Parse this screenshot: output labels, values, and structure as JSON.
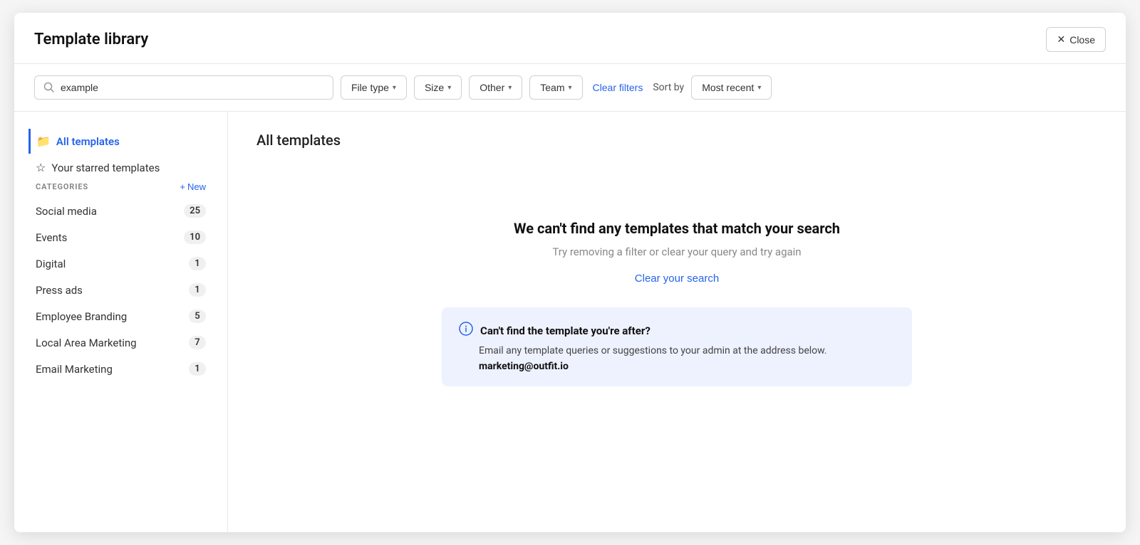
{
  "modal": {
    "title": "Template library"
  },
  "header": {
    "close_label": "Close",
    "close_icon": "×"
  },
  "toolbar": {
    "search_value": "example",
    "search_placeholder": "Search",
    "file_type_label": "File type",
    "size_label": "Size",
    "other_label": "Other",
    "team_label": "Team",
    "clear_filters_label": "Clear filters",
    "sort_by_label": "Sort by",
    "sort_value": "Most recent"
  },
  "sidebar": {
    "all_templates_label": "All templates",
    "starred_templates_label": "Your starred templates",
    "categories_title": "CATEGORIES",
    "new_label": "New",
    "categories": [
      {
        "name": "Social media",
        "count": "25"
      },
      {
        "name": "Events",
        "count": "10"
      },
      {
        "name": "Digital",
        "count": "1"
      },
      {
        "name": "Press ads",
        "count": "1"
      },
      {
        "name": "Employee Branding",
        "count": "5"
      },
      {
        "name": "Local Area Marketing",
        "count": "7"
      },
      {
        "name": "Email Marketing",
        "count": "1"
      }
    ]
  },
  "main": {
    "section_title": "All templates",
    "empty_title": "We can't find any templates that match your search",
    "empty_subtitle": "Try removing a filter or clear your query and try again",
    "clear_search_label": "Clear your search",
    "info_box": {
      "title": "Can't find the template you're after?",
      "body": "Email any template queries or suggestions to your admin at the address below.",
      "email": "marketing@outfit.io"
    }
  },
  "colors": {
    "accent": "#2563eb",
    "info_bg": "#eef2ff"
  }
}
